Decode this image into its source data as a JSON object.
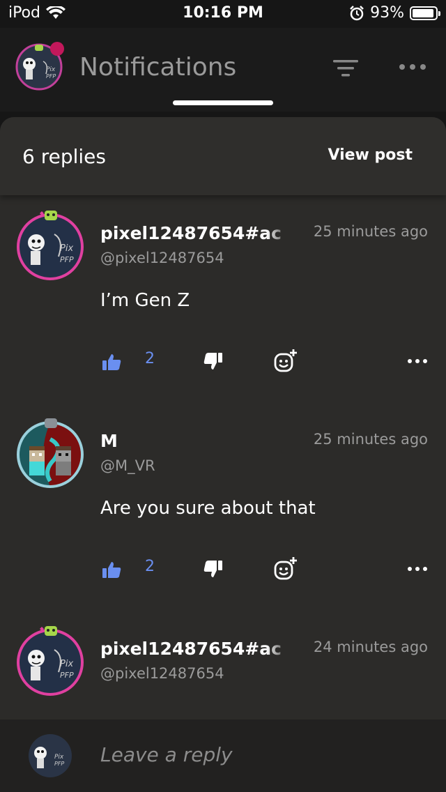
{
  "status_bar": {
    "carrier": "iPod",
    "time": "10:16 PM",
    "battery": "93%",
    "battery_level": 0.93
  },
  "header": {
    "title": "Notifications"
  },
  "sheet": {
    "replies_count": "6 replies",
    "view_post": "View post"
  },
  "comments": [
    {
      "name": "pixel12487654#ac",
      "handle": "@pixel12487654",
      "time": "25 minutes ago",
      "text": "I’m Gen Z",
      "likes": "2"
    },
    {
      "name": "M",
      "handle": "@M_VR",
      "time": "25 minutes ago",
      "text": "Are you sure about that",
      "likes": "2"
    },
    {
      "name": "pixel12487654#ac",
      "handle": "@pixel12487654",
      "time": "24 minutes ago"
    }
  ],
  "reply_bar": {
    "placeholder": "Leave a reply"
  },
  "colors": {
    "like_blue": "#6a8ff0",
    "avatar_ring_pink": "#e040a0",
    "avatar_ring_teal": "#9ad0dc"
  }
}
